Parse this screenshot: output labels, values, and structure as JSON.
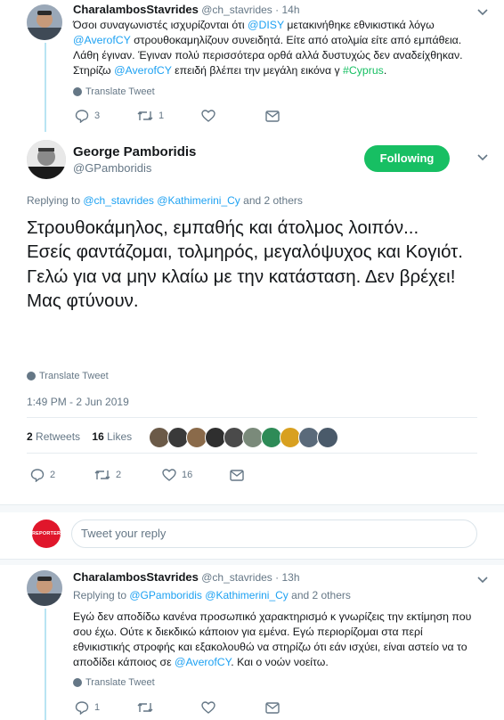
{
  "tweet1": {
    "display_name": "CharalambosStavrides",
    "handle": "@ch_stavrides",
    "time": "· 14h",
    "body": [
      {
        "t": "Όσοι συναγωνιστές ισχυρίζονται ότι "
      },
      {
        "l": "@DISY"
      },
      {
        "t": " μετακινήθηκε εθνικιστικά λόγω "
      },
      {
        "l": "@AverofCY"
      },
      {
        "t": " στρουθοκαμηλίζουν συνειδητά. Είτε από ατολμία είτε από εμπάθεια. Λάθη έγιναν. Έγιναν πολύ περισσότερα ορθά αλλά δυστυχώς δεν αναδείχθηκαν. Στηρίζω "
      },
      {
        "l": "@AverofCY"
      },
      {
        "t": " επειδή βλέπει την μεγάλη εικόνα γ "
      },
      {
        "g": "#Cyprus"
      },
      {
        "t": "."
      }
    ],
    "translate": "Translate Tweet",
    "replies": "3",
    "retweets": "1",
    "likes": ""
  },
  "main_tweet": {
    "display_name": "George Pamboridis",
    "handle": "@GPamboridis",
    "follow_label": "Following",
    "replying_prefix": "Replying to ",
    "replying_to_1": "@ch_stavrides",
    "replying_to_2": "@Kathimerini_Cy",
    "replying_suffix": " and 2 others",
    "body": "Στρουθοκάμηλος, εμπαθής και άτολμος λοιπόν...\nΕσείς φαντάζομαι, τολμηρός, μεγαλόψυχος και Κογιότ.\nΓελώ για να μην κλαίω με την κατάσταση. Δεν βρέχει! Μας φτύνουν.",
    "translate": "Translate Tweet",
    "timestamp": "1:49 PM - 2 Jun 2019",
    "retweets_count": "2",
    "retweets_label": "Retweets",
    "likes_count": "16",
    "likes_label": "Likes",
    "replies": "2",
    "retweets_action": "2",
    "likes_action": "16",
    "liker_colors": [
      "#6b5a48",
      "#3a3a3a",
      "#8a6a4a",
      "#2f2f2f",
      "#4a4a4a",
      "#7a8a7a",
      "#2e8b57",
      "#d8a020",
      "#5a6a7a",
      "#4a5a6a"
    ]
  },
  "reply_box": {
    "avatar_label": "REPORTER",
    "placeholder": "Tweet your reply"
  },
  "tweet3": {
    "display_name": "CharalambosStavrides",
    "handle": "@ch_stavrides",
    "time": "· 13h",
    "replying_prefix": "Replying to ",
    "replying_to_1": "@GPamboridis",
    "replying_to_2": "@Kathimerini_Cy",
    "replying_suffix": " and 2 others",
    "body": [
      {
        "t": "Εγώ δεν αποδίδω κανένα προσωπικό χαρακτηρισμό κ γνωρίζεις την εκτίμηση που σου έχω. Ούτε κ διεκδικώ κάποιον για εμένα. Εγώ περιορίζομαι στα περί εθνικιστικής στροφής και εξακολουθώ να στηρίζω ότι εάν ισχύει, είναι αστείο να το αποδίδει κάποιος σε "
      },
      {
        "l": "@AverofCY"
      },
      {
        "t": ". Και ο νοών νοείτω."
      }
    ],
    "translate": "Translate Tweet",
    "replies": "1",
    "retweets": "",
    "likes": ""
  },
  "colors": {
    "link": "#1da1f2",
    "hashtag": "#17bf63",
    "follow": "#17bf63",
    "thread": "#b9e4f3"
  }
}
